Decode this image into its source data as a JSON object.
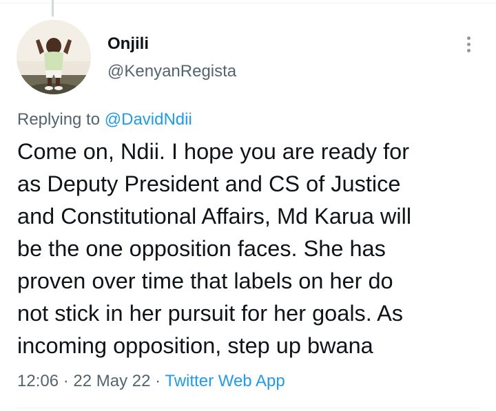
{
  "author": {
    "display_name": "Onjili",
    "handle": "@KenyanRegista",
    "avatar": "avatar-photo"
  },
  "more_icon": "more-vertical-icon",
  "reply": {
    "prefix": "Replying to",
    "mention": "@DavidNdii"
  },
  "tweet": {
    "lines": [
      "Come on, Ndii. I hope you are ready for",
      "as Deputy President and CS of Justice",
      "and Constitutional Affairs, Md Karua will",
      "be the one opposition faces. She has",
      "proven over time that labels on her do",
      "not stick in her pursuit for her goals. As",
      "incoming opposition, step up bwana"
    ]
  },
  "meta": {
    "time": "12:06",
    "separator": "·",
    "date": "22 May 22",
    "source": "Twitter Web App"
  },
  "colors": {
    "accent": "#1d9bf0",
    "secondary_text": "#536471",
    "primary_text": "#0f1419"
  }
}
